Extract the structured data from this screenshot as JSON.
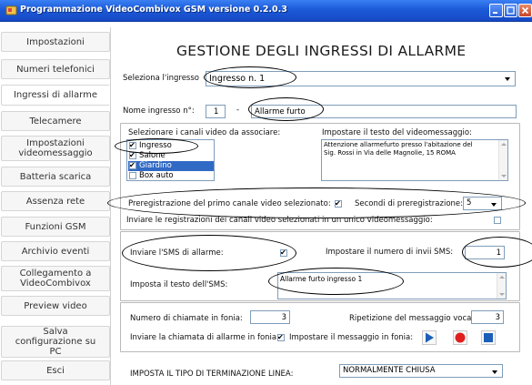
{
  "window": {
    "title": "Programmazione VideoCombivox GSM versione 0.2.0.3"
  },
  "sidebar": {
    "items": [
      {
        "label": "Impostazioni",
        "active": false
      },
      {
        "label": "Numeri telefonici",
        "active": false
      },
      {
        "label": "Ingressi di allarme",
        "active": true
      },
      {
        "label": "Telecamere",
        "active": false
      },
      {
        "label": "Impostazioni videomessaggio",
        "active": false
      },
      {
        "label": "Batteria scarica",
        "active": false
      },
      {
        "label": "Assenza rete",
        "active": false
      },
      {
        "label": "Funzioni GSM",
        "active": false
      },
      {
        "label": "Archivio eventi",
        "active": false
      },
      {
        "label": "Collegamento a VideoCombivox",
        "active": false
      },
      {
        "label": "Preview video",
        "active": false
      },
      {
        "label": "Salva configurazione su PC",
        "active": false
      },
      {
        "label": "Esci",
        "active": false
      }
    ]
  },
  "main": {
    "heading": "GESTIONE DEGLI INGRESSI DI ALLARME",
    "input_select": {
      "label": "Seleziona l'ingresso",
      "value": "Ingresso n. 1"
    },
    "input_name": {
      "label": "Nome ingresso n°:",
      "number": "1",
      "dash": "-",
      "value": "Allarme furto"
    },
    "video": {
      "channels_label": "Selezionare i canali video da associare:",
      "channels": [
        {
          "label": "Ingresso",
          "checked": true,
          "selected": false
        },
        {
          "label": "Salone",
          "checked": true,
          "selected": false
        },
        {
          "label": "Giardino",
          "checked": true,
          "selected": true
        },
        {
          "label": "Box auto",
          "checked": false,
          "selected": false
        }
      ],
      "message_label": "Impostare il testo del videomessaggio:",
      "message_text": "Attenzione allarmefurto presso l'abitazione del\nSig. Rossi in Via delle Magnolie, 15 ROMA",
      "prerec_label": "Preregistrazione del primo canale video selezionato:",
      "prerec_checked": true,
      "prerec_seconds_label": "Secondi di preregistrazione:",
      "prerec_seconds": "5",
      "single_message_label": "Inviare le registrazioni dei canali video selezionati in un unico videomessaggio:",
      "single_message_checked": false
    },
    "sms": {
      "send_label": "Inviare l'SMS di allarme:",
      "send_checked": true,
      "count_label": "Impostare il numero di invii SMS:",
      "count_value": "1",
      "text_label": "Imposta il testo dell'SMS:",
      "text_value": "Allarme furto ingresso 1"
    },
    "voice": {
      "calls_label": "Numero di chiamate in fonia:",
      "calls_value": "3",
      "repeat_label": "Ripetizione del messaggio vocale:",
      "repeat_value": "3",
      "send_call_label": "Inviare la chiamata di allarme in fonia:",
      "send_call_checked": true,
      "set_message_label": "Impostare il messaggio in fonia:"
    },
    "termination": {
      "label": "IMPOSTA IL TIPO DI TERMINAZIONE LINEA:",
      "value": "NORMALMENTE CHIUSA"
    }
  },
  "colors": {
    "play": "#1c5fb8",
    "record": "#e01e1e",
    "stop": "#1c5fb8"
  },
  "icons": [
    "app-icon",
    "minimize-icon",
    "maximize-icon",
    "close-icon",
    "play-icon",
    "record-icon",
    "stop-icon",
    "dropdown-arrow-icon",
    "checkmark-icon"
  ]
}
